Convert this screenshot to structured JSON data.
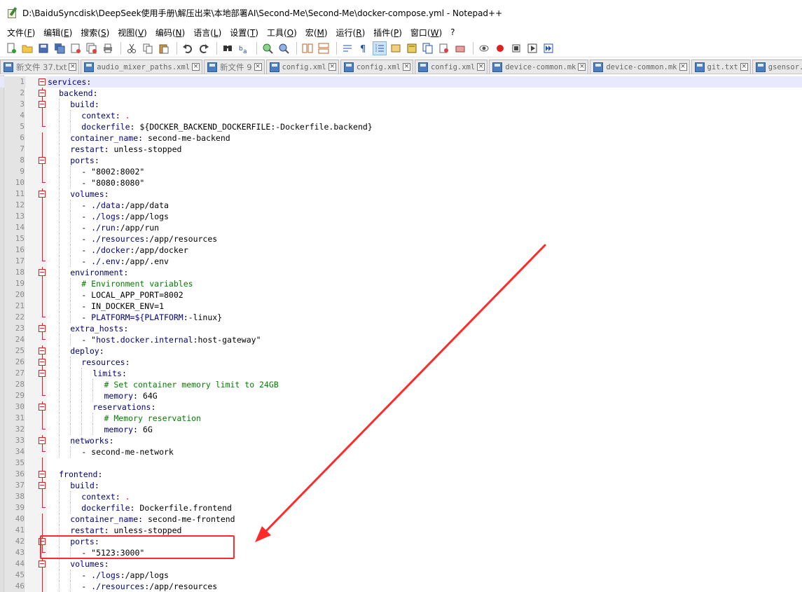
{
  "window": {
    "title": "D:\\BaiduSyncdisk\\DeepSeek使用手册\\解压出来\\本地部署AI\\Second-Me\\Second-Me\\docker-compose.yml - Notepad++",
    "app_icon": "notepad-plus-plus-icon"
  },
  "menu": [
    {
      "label": "文件(",
      "key": "F",
      "suffix": ")"
    },
    {
      "label": "编辑(",
      "key": "E",
      "suffix": ")"
    },
    {
      "label": "搜索(",
      "key": "S",
      "suffix": ")"
    },
    {
      "label": "视图(",
      "key": "V",
      "suffix": ")"
    },
    {
      "label": "编码(",
      "key": "N",
      "suffix": ")"
    },
    {
      "label": "语言(",
      "key": "L",
      "suffix": ")"
    },
    {
      "label": "设置(",
      "key": "T",
      "suffix": ")"
    },
    {
      "label": "工具(",
      "key": "O",
      "suffix": ")"
    },
    {
      "label": "宏(",
      "key": "M",
      "suffix": ")"
    },
    {
      "label": "运行(",
      "key": "R",
      "suffix": ")"
    },
    {
      "label": "插件(",
      "key": "P",
      "suffix": ")"
    },
    {
      "label": "窗口(",
      "key": "W",
      "suffix": ")"
    },
    {
      "label": "?",
      "key": "",
      "suffix": ""
    }
  ],
  "toolbar": [
    "new-file-icon",
    "open-file-icon",
    "save-icon",
    "save-all-icon",
    "close-icon",
    "close-all-icon",
    "print-icon",
    "|",
    "cut-icon",
    "copy-icon",
    "paste-icon",
    "|",
    "undo-icon",
    "redo-icon",
    "|",
    "find-icon",
    "replace-icon",
    "|",
    "zoom-in-icon",
    "zoom-out-icon",
    "|",
    "sync-vertical-icon",
    "sync-horizontal-icon",
    "|",
    "word-wrap-icon",
    "show-all-chars-icon",
    "indent-guide-icon",
    "user-language-icon",
    "doc-map-icon",
    "function-list-icon",
    "folder-workspace-icon",
    "monitor-icon",
    "|",
    "record-macro-icon",
    "stop-macro-icon",
    "play-macro-icon",
    "run-macro-multiple-icon",
    "save-macro-icon"
  ],
  "tabs": [
    {
      "label": "新文件 37.txt",
      "cjk": true
    },
    {
      "label": "audio_mixer_paths.xml",
      "cjk": false
    },
    {
      "label": "新文件 9",
      "cjk": true
    },
    {
      "label": "config.xml",
      "cjk": false
    },
    {
      "label": "config.xml",
      "cjk": false
    },
    {
      "label": "config.xml",
      "cjk": false
    },
    {
      "label": "device-common.mk",
      "cjk": false
    },
    {
      "label": "device-common.mk",
      "cjk": false
    },
    {
      "label": "git.txt",
      "cjk": false
    },
    {
      "label": "gsensor.cfg",
      "cjk": false
    }
  ],
  "code_lines": [
    {
      "n": "1",
      "fold": "open",
      "indent": 0,
      "key": "services",
      "rest": ":"
    },
    {
      "n": "2",
      "fold": "open",
      "indent": 2,
      "key": "backend",
      "rest": ":"
    },
    {
      "n": "3",
      "fold": "open",
      "indent": 4,
      "key": "build",
      "rest": ":"
    },
    {
      "n": "4",
      "fold": "line",
      "indent": 6,
      "key": "context",
      "rest": ": ",
      "dot": "."
    },
    {
      "n": "5",
      "fold": "end",
      "indent": 6,
      "key": "dockerfile",
      "rest": ": ${DOCKER_BACKEND_DOCKERFILE:-Dockerfile.backend}"
    },
    {
      "n": "6",
      "fold": "line",
      "indent": 4,
      "key": "container_name",
      "rest": ": second-me-backend"
    },
    {
      "n": "7",
      "fold": "line",
      "indent": 4,
      "key": "restart",
      "rest": ": unless-stopped"
    },
    {
      "n": "8",
      "fold": "open",
      "indent": 4,
      "key": "ports",
      "rest": ":"
    },
    {
      "n": "9",
      "fold": "line",
      "indent": 6,
      "plain": "- \"8002:8002\""
    },
    {
      "n": "10",
      "fold": "end",
      "indent": 6,
      "plain": "- \"8080:8080\""
    },
    {
      "n": "11",
      "fold": "open",
      "indent": 4,
      "key": "volumes",
      "rest": ":"
    },
    {
      "n": "12",
      "fold": "line",
      "indent": 6,
      "pre": "- ",
      "key": "./data",
      "rest": ":/app/data"
    },
    {
      "n": "13",
      "fold": "line",
      "indent": 6,
      "pre": "- ",
      "key": "./logs",
      "rest": ":/app/logs"
    },
    {
      "n": "14",
      "fold": "line",
      "indent": 6,
      "pre": "- ",
      "key": "./run",
      "rest": ":/app/run"
    },
    {
      "n": "15",
      "fold": "line",
      "indent": 6,
      "pre": "- ",
      "key": "./resources",
      "rest": ":/app/resources"
    },
    {
      "n": "16",
      "fold": "line",
      "indent": 6,
      "pre": "- ",
      "key": "./docker",
      "rest": ":/app/docker"
    },
    {
      "n": "17",
      "fold": "end",
      "indent": 6,
      "pre": "- ",
      "key": "./.env",
      "rest": ":/app/.env"
    },
    {
      "n": "18",
      "fold": "open",
      "indent": 4,
      "key": "environment",
      "rest": ":"
    },
    {
      "n": "19",
      "fold": "line",
      "indent": 6,
      "comment": "# Environment variables"
    },
    {
      "n": "20",
      "fold": "line",
      "indent": 6,
      "plain": "- LOCAL_APP_PORT=8002"
    },
    {
      "n": "21",
      "fold": "line",
      "indent": 6,
      "plain": "- IN_DOCKER_ENV=1"
    },
    {
      "n": "22",
      "fold": "end",
      "indent": 6,
      "pre": "- ",
      "key": "PLATFORM=${PLATFORM",
      "rest": ":-linux}"
    },
    {
      "n": "23",
      "fold": "open",
      "indent": 4,
      "key": "extra_hosts",
      "rest": ":"
    },
    {
      "n": "24",
      "fold": "end",
      "indent": 6,
      "pre": "- \"",
      "key": "host.docker.internal",
      "rest": ":host-gateway\""
    },
    {
      "n": "25",
      "fold": "open",
      "indent": 4,
      "key": "deploy",
      "rest": ":"
    },
    {
      "n": "26",
      "fold": "open",
      "indent": 6,
      "key": "resources",
      "rest": ":"
    },
    {
      "n": "27",
      "fold": "open",
      "indent": 8,
      "key": "limits",
      "rest": ":"
    },
    {
      "n": "28",
      "fold": "line",
      "indent": 10,
      "comment": "# Set container memory limit to 24GB"
    },
    {
      "n": "29",
      "fold": "end",
      "indent": 10,
      "key": "memory",
      "rest": ": 64G"
    },
    {
      "n": "30",
      "fold": "open",
      "indent": 8,
      "key": "reservations",
      "rest": ":"
    },
    {
      "n": "31",
      "fold": "line",
      "indent": 10,
      "comment": "# Memory reservation"
    },
    {
      "n": "32",
      "fold": "end",
      "indent": 10,
      "key": "memory",
      "rest": ": 6G"
    },
    {
      "n": "33",
      "fold": "open",
      "indent": 4,
      "key": "networks",
      "rest": ":"
    },
    {
      "n": "34",
      "fold": "end",
      "indent": 6,
      "plain": "- second-me-network"
    },
    {
      "n": "35",
      "fold": "line",
      "indent": 0,
      "plain": ""
    },
    {
      "n": "36",
      "fold": "open",
      "indent": 2,
      "key": "frontend",
      "rest": ":"
    },
    {
      "n": "37",
      "fold": "open",
      "indent": 4,
      "key": "build",
      "rest": ":"
    },
    {
      "n": "38",
      "fold": "line",
      "indent": 6,
      "key": "context",
      "rest": ": ",
      "dot": "."
    },
    {
      "n": "39",
      "fold": "end",
      "indent": 6,
      "key": "dockerfile",
      "rest": ": Dockerfile.frontend"
    },
    {
      "n": "40",
      "fold": "line",
      "indent": 4,
      "key": "container_name",
      "rest": ": second-me-frontend"
    },
    {
      "n": "41",
      "fold": "line",
      "indent": 4,
      "key": "restart",
      "rest": ": unless-stopped"
    },
    {
      "n": "42",
      "fold": "open",
      "indent": 4,
      "key": "ports",
      "rest": ":"
    },
    {
      "n": "43",
      "fold": "end",
      "indent": 6,
      "plain": "- \"5123:3000\""
    },
    {
      "n": "44",
      "fold": "open",
      "indent": 4,
      "key": "volumes",
      "rest": ":"
    },
    {
      "n": "45",
      "fold": "line",
      "indent": 6,
      "pre": "- ",
      "key": "./logs",
      "rest": ":/app/logs"
    },
    {
      "n": "46",
      "fold": "line",
      "indent": 6,
      "pre": "- ",
      "key": "./resources",
      "rest": ":/app/resources"
    }
  ],
  "colors": {
    "key": "#000080",
    "comment": "#008000",
    "fold_marker": "#e02020",
    "annotation": "#ff2a2a",
    "current_line": "#e8e8ff"
  }
}
